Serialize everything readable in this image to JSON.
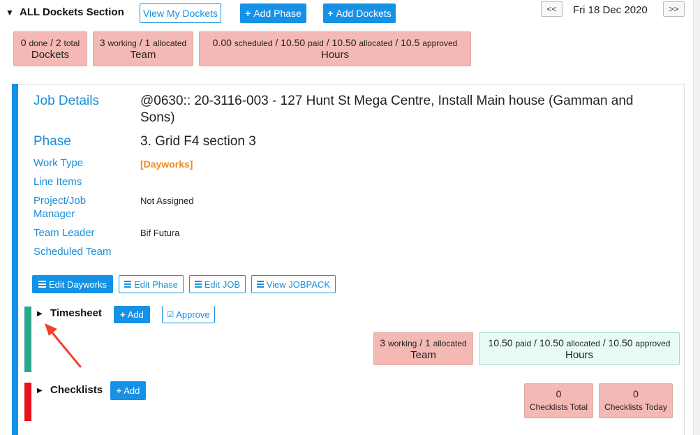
{
  "header": {
    "toggle_icon": "▼",
    "title": "ALL Dockets Section",
    "view_my_dockets": "View My Dockets",
    "add_phase": "Add Phase",
    "add_dockets": "Add Dockets",
    "prev": "<<",
    "next": ">>",
    "date": "Fri 18 Dec 2020"
  },
  "summary": {
    "dockets": {
      "done": "0",
      "done_label": "done",
      "sep": "/",
      "total": "2",
      "total_label": "total",
      "label": "Dockets"
    },
    "team": {
      "working": "3",
      "working_label": "working",
      "sep": "/",
      "allocated": "1",
      "allocated_label": "allocated",
      "label": "Team"
    },
    "hours": {
      "scheduled": "0.00",
      "scheduled_label": "scheduled",
      "paid": "10.50",
      "paid_label": "paid",
      "allocated": "10.50",
      "allocated_label": "allocated",
      "approved": "10.5",
      "approved_label": "approved",
      "label": "Hours"
    }
  },
  "job": {
    "job_details_label": "Job Details",
    "job_details_value": "@0630:: 20-3116-003 - 127 Hunt St Mega Centre, Install Main house (Gamman and Sons)",
    "phase_label": "Phase",
    "phase_value": "3. Grid F4 section 3",
    "work_type_label": "Work Type",
    "work_type_value": "[Dayworks]",
    "line_items_label": "Line Items",
    "pm_label": "Project/Job Manager",
    "pm_value": "Not Assigned",
    "team_leader_label": "Team Leader",
    "team_leader_value": "Bif Futura",
    "scheduled_team_label": "Scheduled Team"
  },
  "actions": {
    "edit_dayworks": "Edit Dayworks",
    "edit_phase": "Edit Phase",
    "edit_job": "Edit JOB",
    "view_jobpack": "View JOBPACK"
  },
  "timesheet": {
    "title": "Timesheet",
    "add": "Add",
    "approve": "Approve",
    "team": {
      "working": "3",
      "working_label": "working",
      "allocated": "1",
      "allocated_label": "allocated",
      "label": "Team"
    },
    "hours": {
      "paid": "10.50",
      "paid_label": "paid",
      "allocated": "10.50",
      "allocated_label": "allocated",
      "approved": "10.50",
      "approved_label": "approved",
      "label": "Hours"
    }
  },
  "checklists": {
    "title": "Checklists",
    "add": "Add",
    "total_value": "0",
    "total_label": "Checklists Total",
    "today_value": "0",
    "today_label": "Checklists Today"
  },
  "colors": {
    "accent": "#1591e6",
    "stat_red": "#f4b9b4",
    "stat_mint": "#e9fbf6",
    "timesheet_bar": "#2aa88a",
    "checklists_bar": "#e8101a",
    "annotation_arrow": "#f2412a",
    "work_type": "#f08a1c"
  }
}
